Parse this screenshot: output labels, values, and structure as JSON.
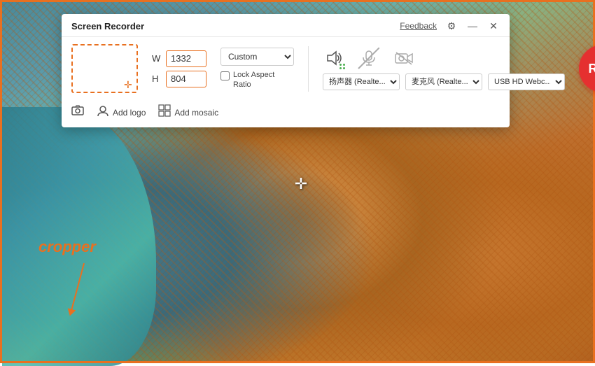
{
  "background": {
    "border_color": "#e87020"
  },
  "panel": {
    "title": "Screen Recorder",
    "feedback_label": "Feedback",
    "settings_icon": "⚙",
    "minimize_icon": "—",
    "close_icon": "✕"
  },
  "selection": {
    "width_label": "W",
    "height_label": "H",
    "width_value": "1332",
    "height_value": "804",
    "preset_label": "Custom",
    "lock_label": "Lock Aspect\nRatio"
  },
  "media": {
    "speaker_icon": "🔊",
    "mic_icon": "🎤",
    "camera_icon": "📷",
    "speaker_select": "扬声器 (Realte...",
    "mic_select": "麦克风 (Realte...",
    "camera_select": "USB HD Webc..."
  },
  "rec_button": {
    "label": "REC"
  },
  "footer": {
    "screenshot_icon": "⊞",
    "logo_icon": "👤",
    "add_logo_label": "Add logo",
    "mosaic_icon": "⊞",
    "add_mosaic_label": "Add mosaic"
  },
  "cropper": {
    "label": "cropper"
  }
}
